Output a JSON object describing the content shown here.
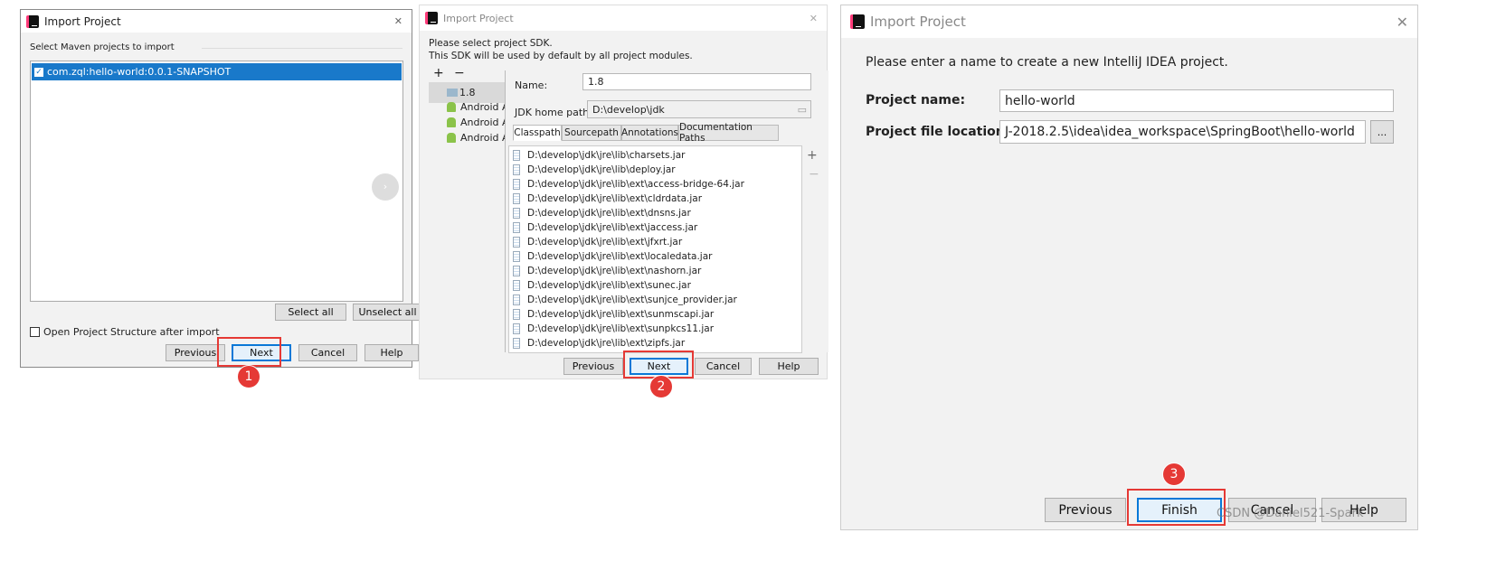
{
  "dialog1": {
    "title": "Import Project",
    "section_label": "Select Maven projects to import",
    "projects": [
      {
        "label": "com.zql:hello-world:0.0.1-SNAPSHOT",
        "checked": true
      }
    ],
    "select_all": "Select all",
    "unselect_all": "Unselect all",
    "open_structure_label": "Open Project Structure after import",
    "open_structure_checked": false,
    "buttons": {
      "previous": "Previous",
      "next": "Next",
      "cancel": "Cancel",
      "help": "Help"
    },
    "step_badge": "1"
  },
  "dialog2": {
    "title": "Import Project",
    "line1": "Please select project SDK.",
    "line2": "This SDK will be used by default by all project modules.",
    "add": "+",
    "remove": "−",
    "sdks": [
      "1.8",
      "Android A",
      "Android A",
      "Android A"
    ],
    "name_label": "Name:",
    "name_value": "1.8",
    "jdk_label": "JDK home path:",
    "jdk_value": "D:\\develop\\jdk",
    "tabs": [
      "Classpath",
      "Sourcepath",
      "Annotations",
      "Documentation Paths"
    ],
    "classpath": [
      "D:\\develop\\jdk\\jre\\lib\\charsets.jar",
      "D:\\develop\\jdk\\jre\\lib\\deploy.jar",
      "D:\\develop\\jdk\\jre\\lib\\ext\\access-bridge-64.jar",
      "D:\\develop\\jdk\\jre\\lib\\ext\\cldrdata.jar",
      "D:\\develop\\jdk\\jre\\lib\\ext\\dnsns.jar",
      "D:\\develop\\jdk\\jre\\lib\\ext\\jaccess.jar",
      "D:\\develop\\jdk\\jre\\lib\\ext\\jfxrt.jar",
      "D:\\develop\\jdk\\jre\\lib\\ext\\localedata.jar",
      "D:\\develop\\jdk\\jre\\lib\\ext\\nashorn.jar",
      "D:\\develop\\jdk\\jre\\lib\\ext\\sunec.jar",
      "D:\\develop\\jdk\\jre\\lib\\ext\\sunjce_provider.jar",
      "D:\\develop\\jdk\\jre\\lib\\ext\\sunmscapi.jar",
      "D:\\develop\\jdk\\jre\\lib\\ext\\sunpkcs11.jar",
      "D:\\develop\\jdk\\jre\\lib\\ext\\zipfs.jar"
    ],
    "buttons": {
      "previous": "Previous",
      "next": "Next",
      "cancel": "Cancel",
      "help": "Help"
    },
    "step_badge": "2"
  },
  "dialog3": {
    "title": "Import Project",
    "intro": "Please enter a name to create a new IntelliJ IDEA project.",
    "name_label": "Project name:",
    "name_value": "hello-world",
    "location_label": "Project file location:",
    "location_value": "J-2018.2.5\\idea\\idea_workspace\\SpringBoot\\hello-world",
    "browse": "...",
    "buttons": {
      "previous": "Previous",
      "finish": "Finish",
      "cancel": "Cancel",
      "help": "Help"
    },
    "step_badge": "3"
  },
  "watermark": "CSDN @Daniel521-Spark",
  "colors": {
    "selection": "#1979ca",
    "highlight": "#e53935",
    "default_button": "#0a78d7"
  }
}
